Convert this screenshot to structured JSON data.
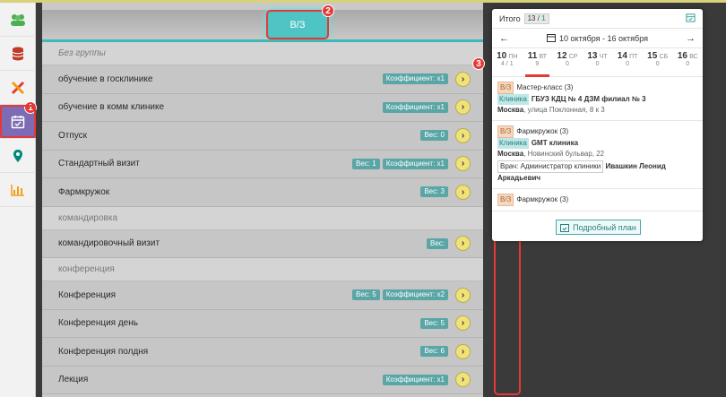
{
  "sidebar": {
    "items": [
      {
        "icon": "users-icon",
        "color": "#4caf50"
      },
      {
        "icon": "database-icon",
        "color": "#c0392b"
      },
      {
        "icon": "tools-icon",
        "color": "#e53935"
      },
      {
        "icon": "calendar-check-icon",
        "color": "#ffffff"
      },
      {
        "icon": "map-marker-icon",
        "color": "#00897b"
      },
      {
        "icon": "bar-chart-icon",
        "color": "#f39c12"
      }
    ],
    "marker_1": "1"
  },
  "tabs": {
    "vz_label": "В/З",
    "marker_2": "2",
    "marker_3": "3"
  },
  "groups": [
    {
      "title": "Без группы",
      "italic": true,
      "rows": [
        {
          "name": "обучение в госклинике",
          "badges": [
            "Коэффициент: x1"
          ]
        },
        {
          "name": "обучение в комм клинике",
          "badges": [
            "Коэффициент: x1"
          ]
        },
        {
          "name": "Отпуск",
          "badges": [
            "Вес: 0"
          ]
        },
        {
          "name": "Стандартный визит",
          "badges": [
            "Вес: 1",
            "Коэффициент: x1"
          ]
        },
        {
          "name": "Фармкружок",
          "badges": [
            "Вес: 3"
          ]
        }
      ]
    },
    {
      "title": "командировка",
      "italic": false,
      "rows": [
        {
          "name": "командировочный визит",
          "badges": [
            "Вес:"
          ]
        }
      ]
    },
    {
      "title": "конференция",
      "italic": false,
      "rows": [
        {
          "name": "Конференция",
          "badges": [
            "Вес: 5",
            "Коэффициент: x2"
          ]
        },
        {
          "name": "Конференция день",
          "badges": [
            "Вес: 5"
          ]
        },
        {
          "name": "Конференция полдня",
          "badges": [
            "Вес: 6"
          ]
        },
        {
          "name": "Лекция",
          "badges": [
            "Коэффициент: x1"
          ]
        }
      ]
    }
  ],
  "calendar": {
    "total_label": "Итого",
    "total_count": "13",
    "total_sep": " / ",
    "total_done": "1",
    "range": "10 октября - 16 октября",
    "days": [
      {
        "num": "10",
        "wd": "ПН",
        "count": "4 / 1"
      },
      {
        "num": "11",
        "wd": "ВТ",
        "count": "9"
      },
      {
        "num": "12",
        "wd": "СР",
        "count": "0"
      },
      {
        "num": "13",
        "wd": "ЧТ",
        "count": "0"
      },
      {
        "num": "14",
        "wd": "ПТ",
        "count": "0"
      },
      {
        "num": "15",
        "wd": "СБ",
        "count": "0"
      },
      {
        "num": "16",
        "wd": "ВС",
        "count": "0"
      }
    ],
    "events": [
      {
        "tag": "В/З",
        "title": "Мастер-класс (3)",
        "kl": "Клиника",
        "clinic": "ГБУЗ КДЦ № 4 ДЗМ филиал № 3",
        "city": "Москва",
        "addr": ", улица Поклонная, 8 к 3"
      },
      {
        "tag": "В/З",
        "title": "Фармкружок (3)",
        "kl": "Клиника",
        "clinic": "GMT клиника",
        "city": "Москва",
        "addr": ", Новинский бульвар, 22",
        "doc_label": "Врач: Администратор клиники",
        "doc_name": "Ивашкин Леонид Аркадьевич"
      },
      {
        "tag": "В/З",
        "title": "Фармкружок (3)"
      }
    ],
    "plan_button": "Подробный план"
  }
}
